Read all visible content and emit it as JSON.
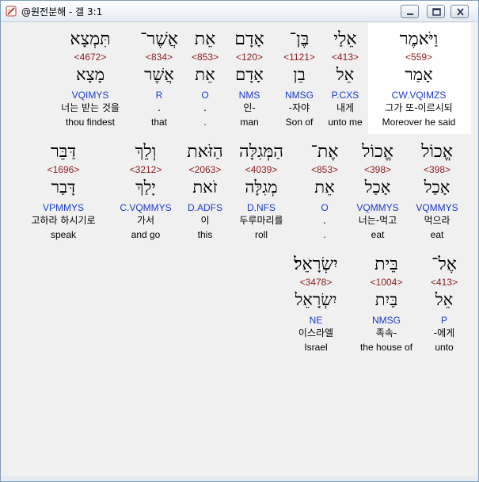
{
  "window": {
    "title": "@원전분해 - 겔 3:1",
    "app_icon": "book-icon",
    "buttons": {
      "minimize": "minimize-icon",
      "maximize": "maximize-icon",
      "close": "close-icon"
    }
  },
  "verse": {
    "rows": [
      {
        "words": [
          {
            "hebrew": "וַיֹּאמֶר",
            "strong": "<559>",
            "lemma": "אָמַר",
            "parse": "CW.VQIMZS",
            "korean": "그가 또-이르시되",
            "english": "Moreover he said",
            "selected": true
          },
          {
            "hebrew": "אֵלַי",
            "strong": "<413>",
            "lemma": "אֵל",
            "parse": "P.CXS",
            "korean": "내게",
            "english": "unto me"
          },
          {
            "hebrew": "בֶּן־",
            "strong": "<1121>",
            "lemma": "בֵן",
            "parse": "NMSG",
            "korean": "-자야",
            "english": "Son of"
          },
          {
            "hebrew": "אָדָם",
            "strong": "<120>",
            "lemma": "אָדָם",
            "parse": "NMS",
            "korean": "인-",
            "english": "man"
          },
          {
            "hebrew": "אֵת",
            "strong": "<853>",
            "lemma": "אֵת",
            "parse": "O",
            "korean": ".",
            "english": "."
          },
          {
            "hebrew": "אֲשֶׁר־",
            "strong": "<834>",
            "lemma": "אֲשֶׁר",
            "parse": "R",
            "korean": ".",
            "english": "that"
          },
          {
            "hebrew": "תִּמְצָא",
            "strong": "<4672>",
            "lemma": "מָצָא",
            "parse": "VQIMYS",
            "korean": "너는 받는 것을",
            "english": "thou findest"
          }
        ]
      },
      {
        "words": [
          {
            "hebrew": "אֱכוֹל",
            "strong": "<398>",
            "lemma": "אָכַל",
            "parse": "VQMMYS",
            "korean": "먹으라",
            "english": "eat"
          },
          {
            "hebrew": "אֱכוֹל",
            "strong": "<398>",
            "lemma": "אָכַל",
            "parse": "VQMMYS",
            "korean": "너는-먹고",
            "english": "eat"
          },
          {
            "hebrew": "אֶת־",
            "strong": "<853>",
            "lemma": "אֵת",
            "parse": "O",
            "korean": ".",
            "english": "."
          },
          {
            "hebrew": "הַמְּגִלָּה",
            "strong": "<4039>",
            "lemma": "מְגִלָּה",
            "parse": "D.NFS",
            "korean": "두루마리를",
            "english": "roll"
          },
          {
            "hebrew": "הַזֹּאת",
            "strong": "<2063>",
            "lemma": "זֹאת",
            "parse": "D.ADFS",
            "korean": "이",
            "english": "this"
          },
          {
            "hebrew": "וְלֵךְ",
            "strong": "<3212>",
            "lemma": "יָלַךְ",
            "parse": "C.VQMMYS",
            "korean": "가서",
            "english": "and go"
          },
          {
            "hebrew": "דַּבֵּר",
            "strong": "<1696>",
            "lemma": "דָּבַר",
            "parse": "VPMMYS",
            "korean": "고하라 하시기로",
            "english": "speak"
          }
        ]
      },
      {
        "words": [
          {
            "hebrew": "אֶל־",
            "strong": "<413>",
            "lemma": "אֵל",
            "parse": "P",
            "korean": "-에게",
            "english": "unto"
          },
          {
            "hebrew": "בֵּית",
            "strong": "<1004>",
            "lemma": "בַּיִת",
            "parse": "NMSG",
            "korean": "족속-",
            "english": "the house of"
          },
          {
            "hebrew": "יִשְׂרָאֵל׃",
            "strong": "<3478>",
            "lemma": "יִשְׂרָאֵל",
            "parse": "NE",
            "korean": "이스라엘",
            "english": "Israel"
          }
        ]
      }
    ]
  }
}
